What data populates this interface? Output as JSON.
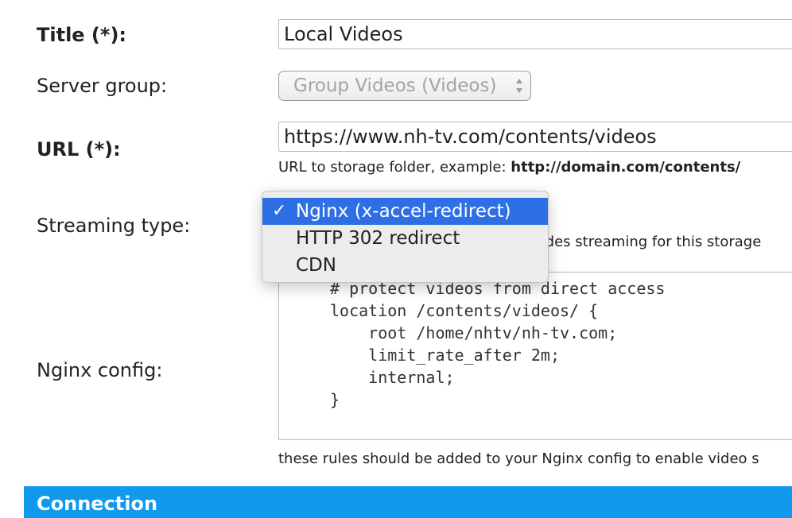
{
  "form": {
    "title": {
      "label": "Title (*):",
      "value": "Local Videos"
    },
    "server_group": {
      "label": "Server group:",
      "value": "Group Videos (Videos)"
    },
    "url": {
      "label": "URL (*):",
      "value": "https://www.nh-tv.com/contents/videos",
      "hint_prefix": "URL to storage folder, example: ",
      "hint_example": "http://domain.com/contents/"
    },
    "streaming_type": {
      "label": "Streaming type:",
      "hint_partial": "vides streaming for this storage",
      "options": [
        {
          "label": "Nginx (x-accel-redirect)",
          "selected": true,
          "check": "✓"
        },
        {
          "label": "HTTP 302 redirect",
          "selected": false
        },
        {
          "label": "CDN",
          "selected": false
        }
      ]
    },
    "nginx_config": {
      "label": "Nginx config:",
      "code": "# protect videos from direct access\nlocation /contents/videos/ {\n    root /home/nhtv/nh-tv.com;\n    limit_rate_after 2m;\n    internal;\n}",
      "hint": "these rules should be added to your Nginx config to enable video s"
    }
  },
  "section": {
    "title": "Connection"
  },
  "colors": {
    "section_bar": "#1199ee",
    "dropdown_selected": "#2e6fe6"
  }
}
